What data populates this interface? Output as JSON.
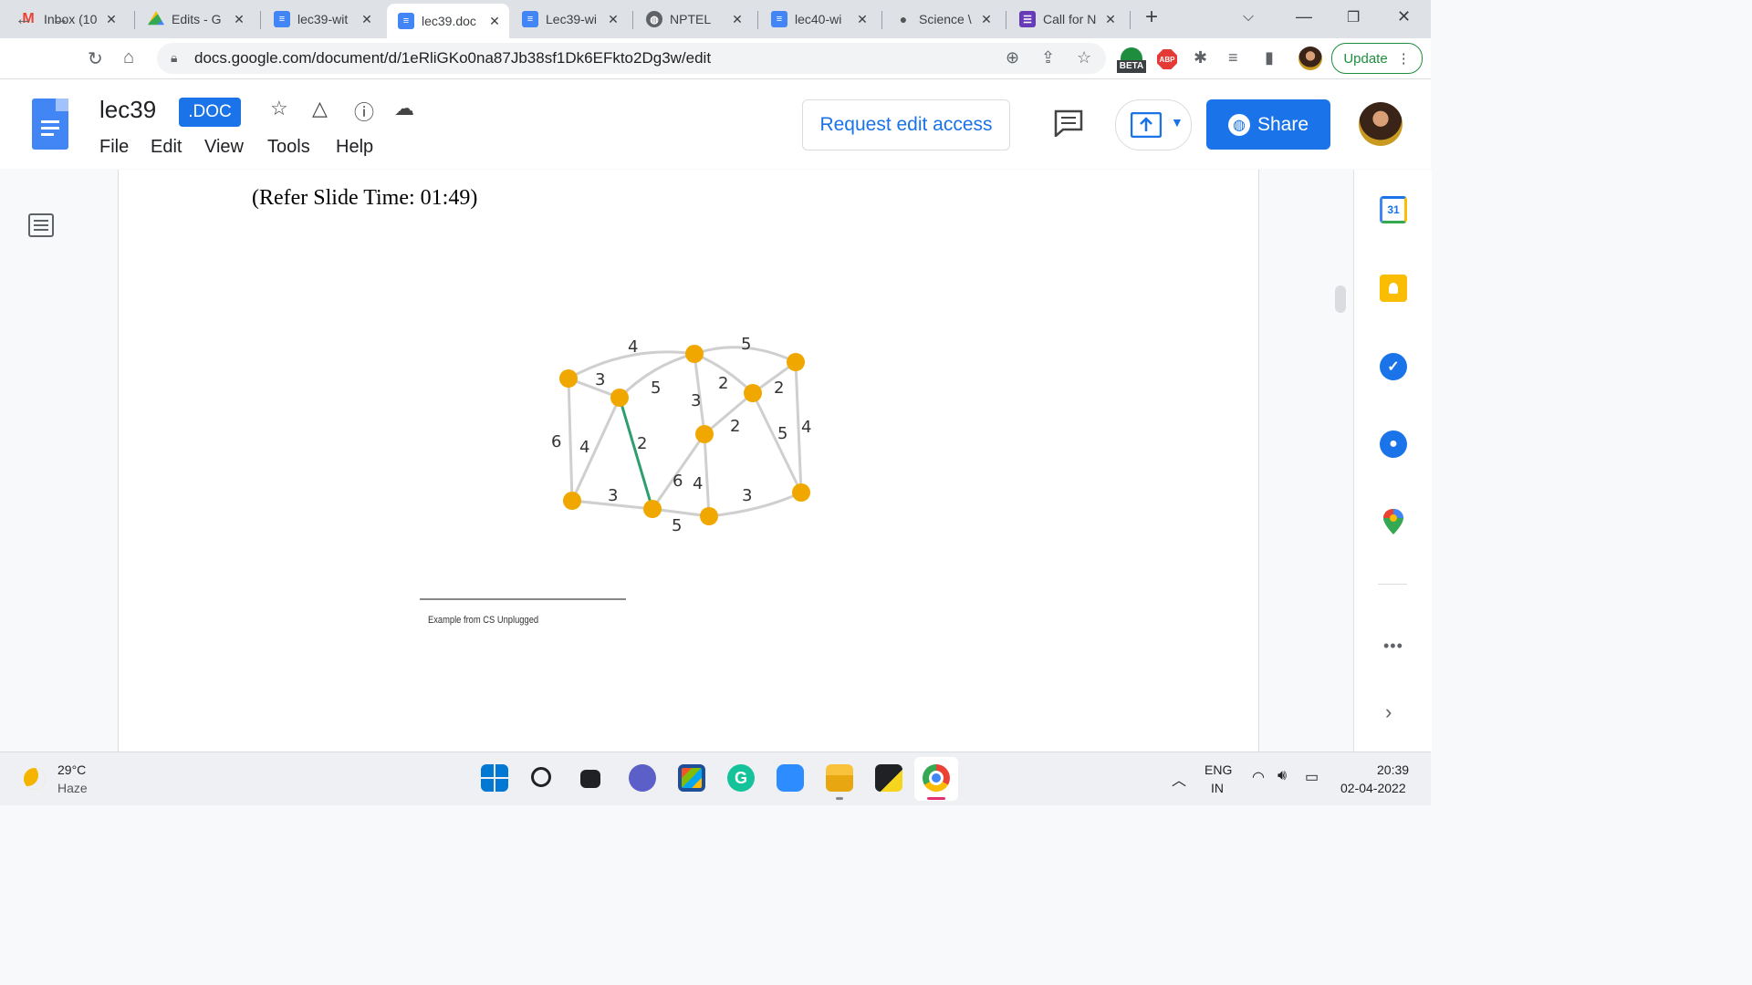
{
  "tabs": [
    {
      "title": "Inbox (10",
      "icon": "gmail-icon",
      "active": false
    },
    {
      "title": "Edits - G",
      "icon": "drive-icon",
      "active": false
    },
    {
      "title": "lec39-wit",
      "icon": "docs-icon",
      "active": false
    },
    {
      "title": "lec39.doc",
      "icon": "docs-icon",
      "active": true
    },
    {
      "title": "Lec39-wi",
      "icon": "docs-icon",
      "active": false
    },
    {
      "title": "NPTEL",
      "icon": "globe-icon",
      "active": false
    },
    {
      "title": "lec40-wi",
      "icon": "docs-icon",
      "active": false
    },
    {
      "title": "Science \\",
      "icon": "chat-icon",
      "active": false
    },
    {
      "title": "Call for N",
      "icon": "forms-icon",
      "active": false
    }
  ],
  "address_bar": {
    "url": "docs.google.com/document/d/1eRliGKo0na87Jb38sf1Dk6EFkto2Dg3w/edit"
  },
  "extensions": {
    "beta_label": "BETA",
    "abp_label": "ABP",
    "update_label": "Update"
  },
  "doc": {
    "title": "lec39",
    "badge": ".DOC",
    "menu": [
      "File",
      "Edit",
      "View",
      "Tools",
      "Help"
    ],
    "request_edit_label": "Request edit access",
    "share_label": "Share"
  },
  "content": {
    "refer_text": "(Refer Slide Time: 01:49)",
    "caption": "Example from CS Unplugged",
    "graph": {
      "edge_weights": [
        "4",
        "5",
        "3",
        "5",
        "3",
        "2",
        "2",
        "6",
        "4",
        "2",
        "2",
        "5",
        "4",
        "6",
        "4",
        "3",
        "3",
        "5"
      ]
    }
  },
  "side_panel": {
    "calendar_day": "31"
  },
  "taskbar": {
    "weather_temp": "29°C",
    "weather_desc": "Haze",
    "lang_top": "ENG",
    "lang_bottom": "IN",
    "time": "20:39",
    "date": "02-04-2022"
  },
  "colors": {
    "accent": "#1a73e8",
    "node": "#f0a800",
    "highlight_edge": "#2e9e6e"
  }
}
